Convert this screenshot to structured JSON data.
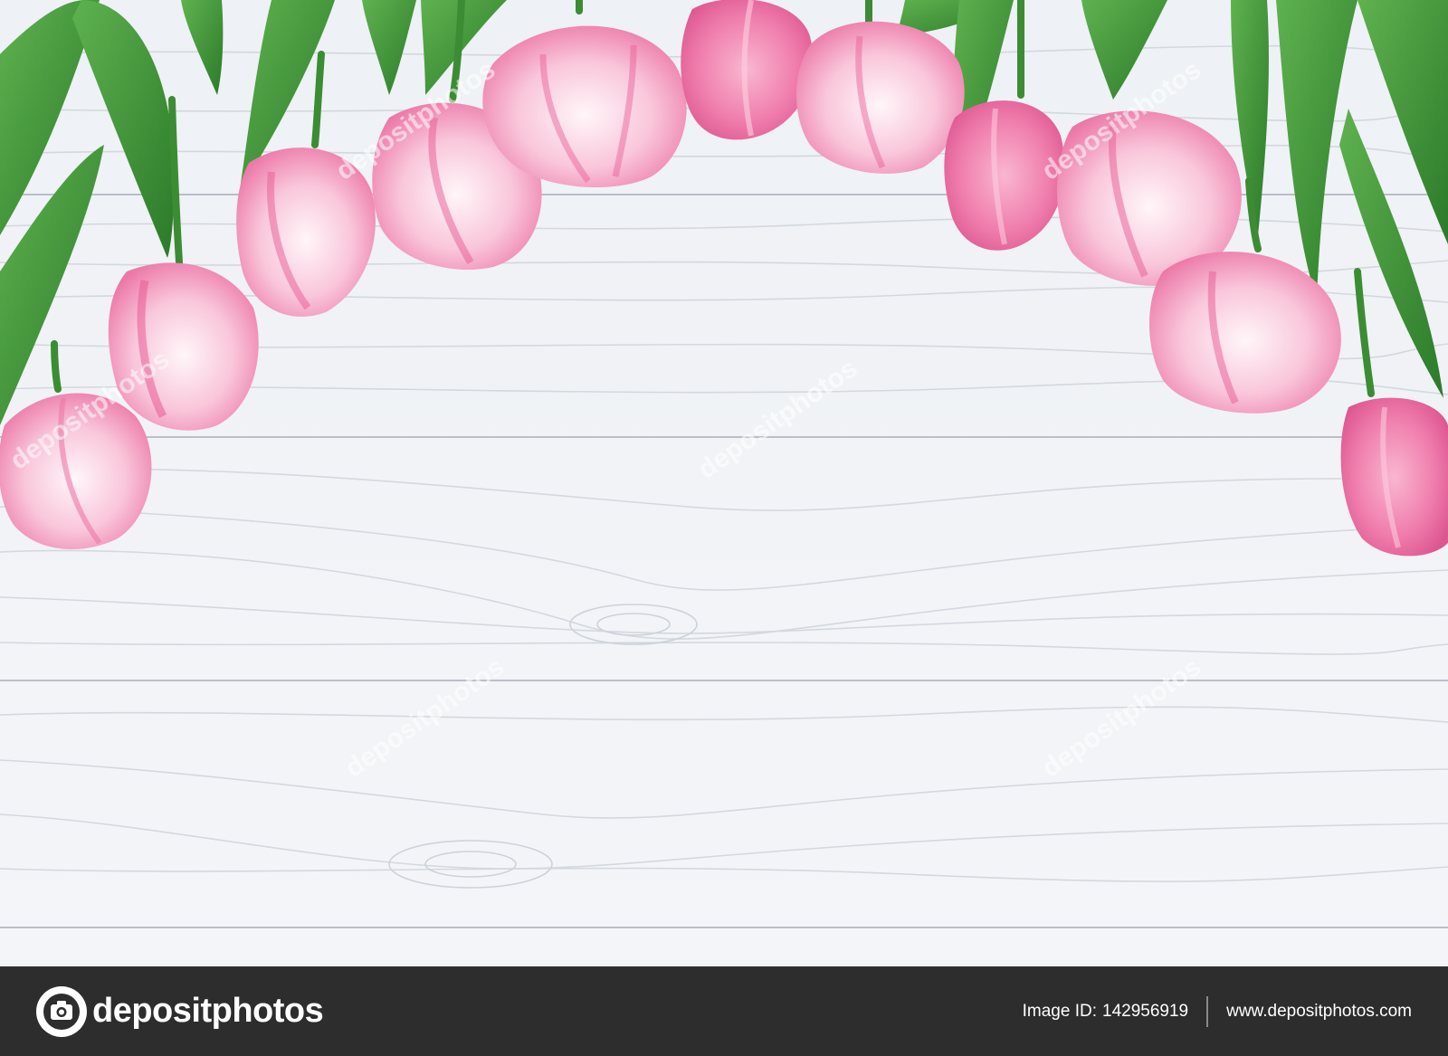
{
  "footer": {
    "logo_text": "depositphotos",
    "image_id_label": "Image ID:",
    "image_id_value": "142956919",
    "site_url": "www.depositphotos.com"
  },
  "watermark": {
    "text": "depositphotos"
  },
  "colors": {
    "wood": "#f1f3f6",
    "plank_line": "#c9ced6",
    "tulip_light": "#fbe3ec",
    "tulip_pink": "#f28bb4",
    "tulip_deep": "#e45c93",
    "leaf": "#3f9a3a",
    "leaf_dark": "#2b7a2a",
    "footer_bg": "#2d2d2d"
  }
}
